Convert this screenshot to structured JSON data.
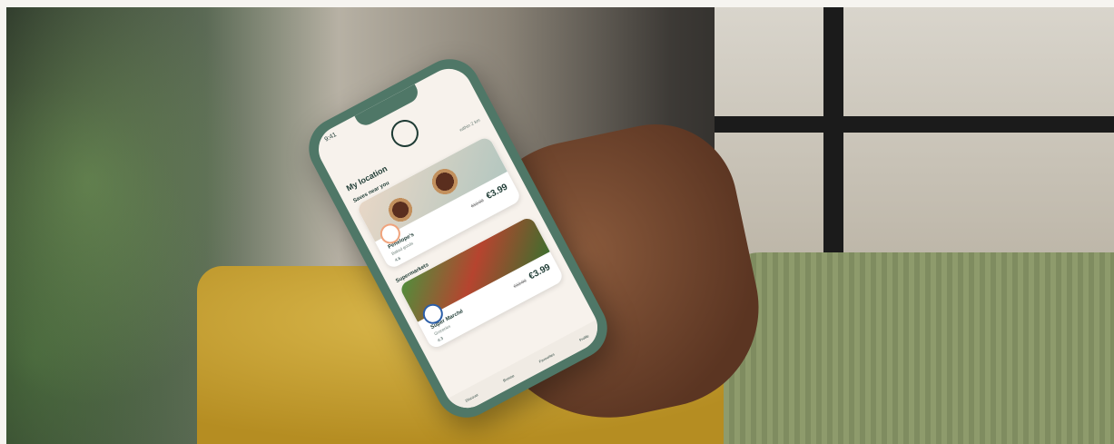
{
  "phone": {
    "status_time": "9:41",
    "location_title": "My location",
    "location_sub": "within 2 km",
    "section_1": {
      "title": "Saves near you",
      "view_all": "View all"
    },
    "card_1": {
      "name": "Penelope's",
      "subtitle": "Baked goods",
      "old_price": "€12.00",
      "price": "€3.99",
      "rating": "4.6"
    },
    "section_2": {
      "title": "Supermarkets",
      "view_all": "View all"
    },
    "card_2": {
      "name": "Super Marché",
      "subtitle": "Groceries",
      "old_price": "€12.00",
      "price": "€3.99",
      "rating": "4.3"
    },
    "nav": [
      "Discover",
      "Browse",
      "Favourites",
      "Profile"
    ]
  }
}
